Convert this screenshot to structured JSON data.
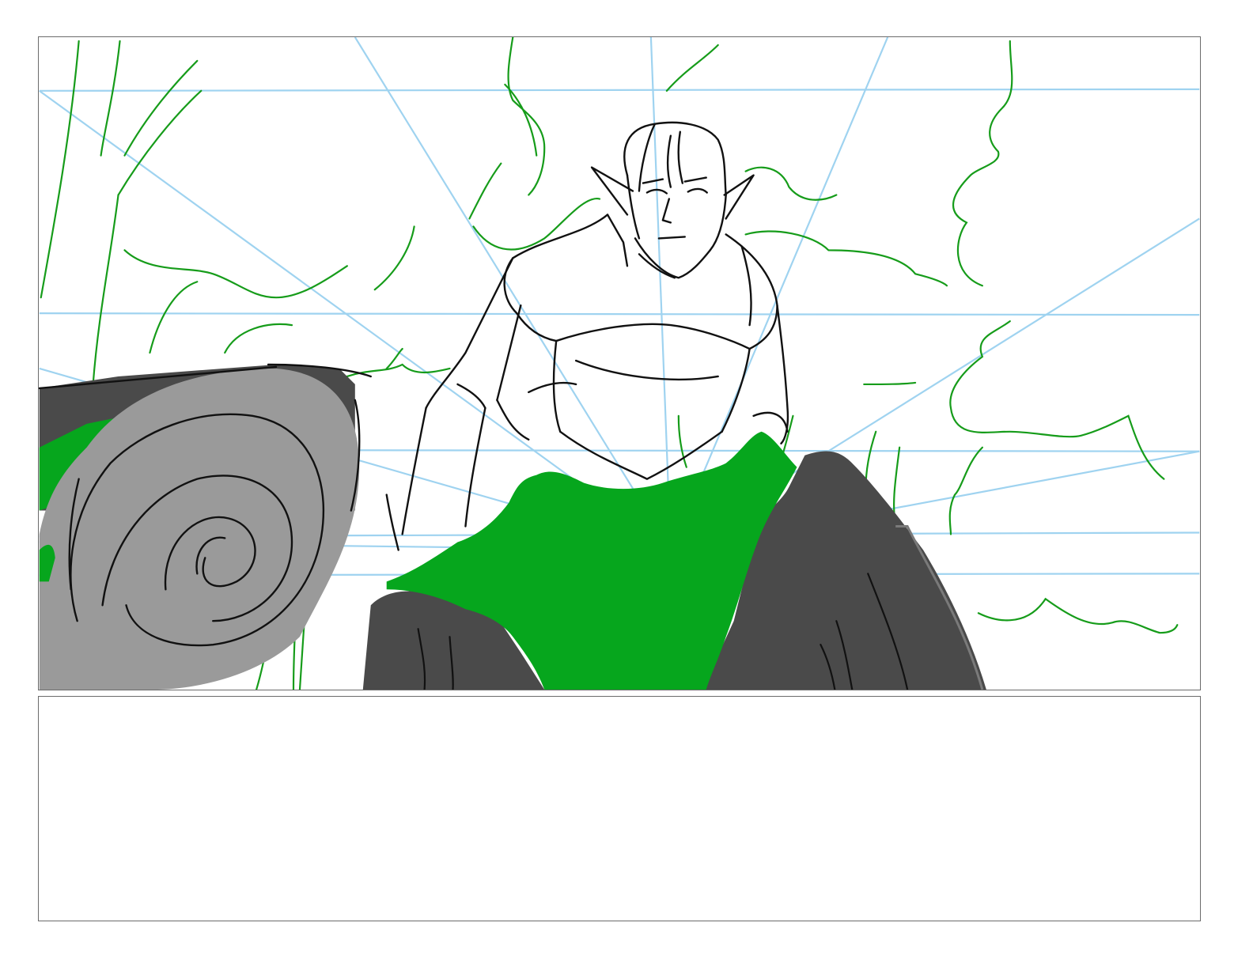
{
  "storyboard": {
    "panel": {
      "image_label": "storyboard-sketch",
      "subject": [
        "armored-elf-character",
        "log",
        "moss-covered-rock",
        "forest-foliage",
        "perspective-guide-lines"
      ]
    },
    "notes": {
      "text": ""
    }
  },
  "colors": {
    "guide_line": "#9fd3f0",
    "foliage_line": "#169c1a",
    "moss_fill": "#06a61d",
    "rock_fill": "#4a4a4a",
    "log_fill": "#9a9a9a",
    "ink": "#111111",
    "frame_border": "#6b6b6b"
  }
}
